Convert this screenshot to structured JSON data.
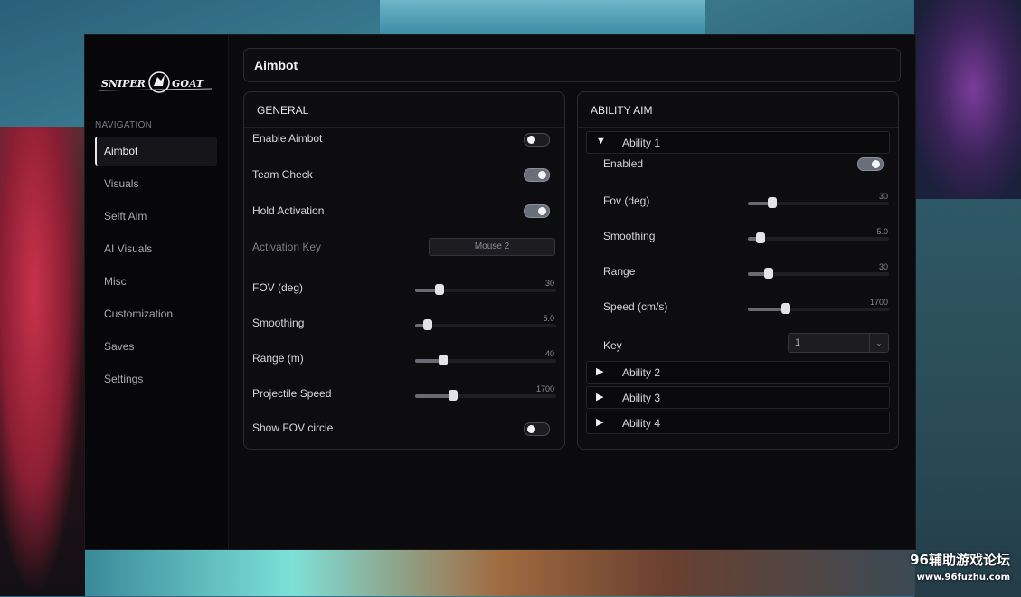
{
  "brand": {
    "logo_text": "SNIPER GOAT"
  },
  "watermark": {
    "line1": "96辅助游戏论坛",
    "line2": "www.96fuzhu.com"
  },
  "sidebar": {
    "heading": "NAVIGATION",
    "items": [
      {
        "label": "Aimbot",
        "active": true
      },
      {
        "label": "Visuals"
      },
      {
        "label": "Selft Aim"
      },
      {
        "label": "AI Visuals"
      },
      {
        "label": "Misc"
      },
      {
        "label": "Customization"
      },
      {
        "label": "Saves"
      },
      {
        "label": "Settings"
      }
    ]
  },
  "page": {
    "title": "Aimbot"
  },
  "general": {
    "header": "GENERAL",
    "enable_aimbot": {
      "label": "Enable Aimbot",
      "on": false
    },
    "team_check": {
      "label": "Team Check",
      "on": true
    },
    "hold_activation": {
      "label": "Hold Activation",
      "on": true
    },
    "activation_key": {
      "label": "Activation Key",
      "value": "Mouse 2"
    },
    "fov": {
      "label": "FOV (deg)",
      "value": "30",
      "fraction": 0.17
    },
    "smoothing": {
      "label": "Smoothing",
      "value": "5.0",
      "fraction": 0.09
    },
    "range": {
      "label": "Range (m)",
      "value": "40",
      "fraction": 0.2
    },
    "projectile_speed": {
      "label": "Projectile Speed",
      "value": "1700",
      "fraction": 0.27
    },
    "show_fov_circle": {
      "label": "Show FOV circle",
      "on": false
    }
  },
  "ability_aim": {
    "header": "ABILITY AIM",
    "ability1": {
      "label": "Ability 1",
      "expanded": true,
      "enabled": {
        "label": "Enabled",
        "on": true
      },
      "fov": {
        "label": "Fov (deg)",
        "value": "30",
        "fraction": 0.17
      },
      "smoothing": {
        "label": "Smoothing",
        "value": "5.0",
        "fraction": 0.09
      },
      "range": {
        "label": "Range",
        "value": "30",
        "fraction": 0.15
      },
      "speed": {
        "label": "Speed (cm/s)",
        "value": "1700",
        "fraction": 0.27
      },
      "key": {
        "label": "Key",
        "value": "1"
      }
    },
    "ability2": {
      "label": "Ability 2"
    },
    "ability3": {
      "label": "Ability 3"
    },
    "ability4": {
      "label": "Ability 4"
    },
    "arrow_expanded": "▼",
    "arrow_collapsed": "▶"
  },
  "colors": {
    "accent_toggle_on": "#6a6e78",
    "panel_bg": "#0d0d10",
    "window_bg": "#0b0b0e"
  }
}
